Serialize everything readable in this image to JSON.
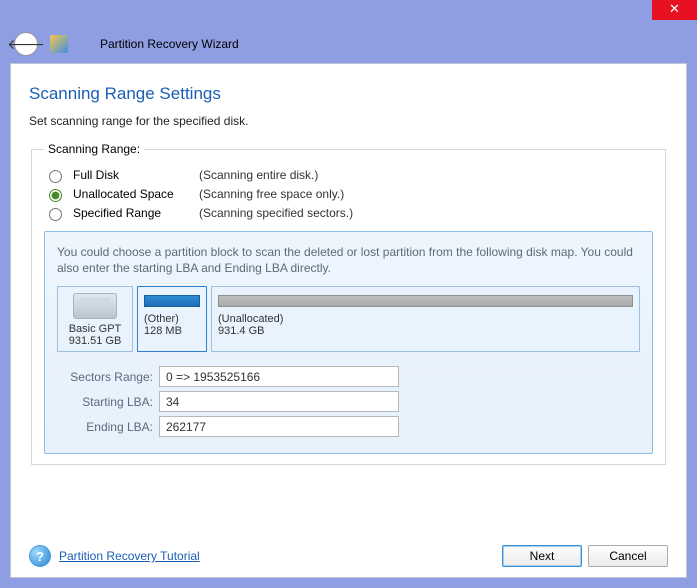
{
  "window": {
    "title": "Partition Recovery Wizard"
  },
  "page": {
    "title": "Scanning Range Settings",
    "description": "Set scanning range for the specified disk."
  },
  "scanningRange": {
    "legend": "Scanning Range:",
    "options": [
      {
        "label": "Full Disk",
        "hint": "(Scanning entire disk.)",
        "checked": false
      },
      {
        "label": "Unallocated Space",
        "hint": "(Scanning free space only.)",
        "checked": true
      },
      {
        "label": "Specified Range",
        "hint": "(Scanning specified sectors.)",
        "checked": false
      }
    ]
  },
  "detail": {
    "text": "You could choose a partition block to scan the deleted or lost partition from the following disk map. You could also enter the starting LBA and Ending LBA directly.",
    "disk": {
      "name": "Basic GPT",
      "size": "931.51 GB"
    },
    "partitions": [
      {
        "label": "(Other)",
        "size": "128 MB",
        "filled": true,
        "selected": true
      },
      {
        "label": "(Unallocated)",
        "size": "931.4 GB",
        "filled": false,
        "selected": false
      }
    ],
    "fields": {
      "sectorsRangeLabel": "Sectors Range:",
      "sectorsRangeValue": "0 => 1953525166",
      "startingLbaLabel": "Starting LBA:",
      "startingLbaValue": "34",
      "endingLbaLabel": "Ending LBA:",
      "endingLbaValue": "262177"
    }
  },
  "footer": {
    "tutorialLink": "Partition Recovery Tutorial",
    "next": "Next",
    "cancel": "Cancel"
  }
}
